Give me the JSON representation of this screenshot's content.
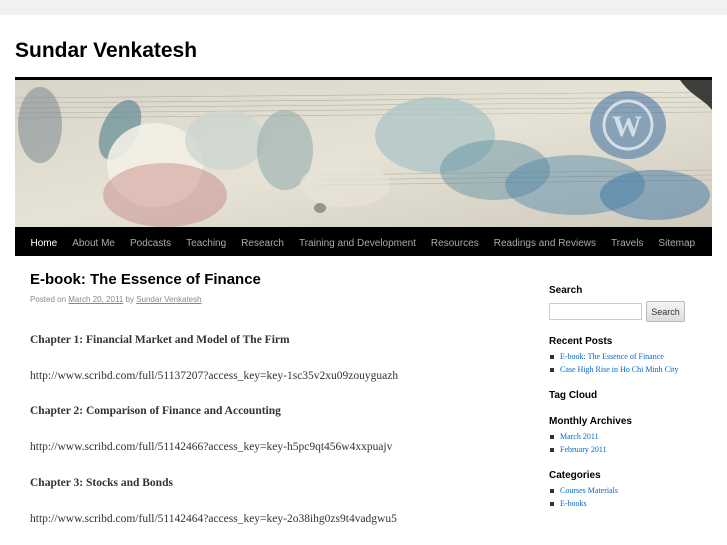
{
  "site": {
    "title": "Sundar Venkatesh"
  },
  "nav": {
    "items": [
      {
        "label": "Home",
        "current": true
      },
      {
        "label": "About Me"
      },
      {
        "label": "Podcasts"
      },
      {
        "label": "Teaching"
      },
      {
        "label": "Research"
      },
      {
        "label": "Training and Development"
      },
      {
        "label": "Resources"
      },
      {
        "label": "Readings and Reviews"
      },
      {
        "label": "Travels"
      },
      {
        "label": "Sitemap"
      }
    ]
  },
  "post": {
    "title": "E-book: The Essence of Finance",
    "meta": {
      "posted_on": "Posted on",
      "date": "March 20, 2011",
      "by": "by",
      "author": "Sundar Venkatesh"
    },
    "chapters": [
      {
        "heading": "Chapter 1: Financial Market and Model of The Firm",
        "link": "http://www.scribd.com/full/51137207?access_key=key-1sc35v2xu09zouyguazh"
      },
      {
        "heading": "Chapter 2: Comparison of Finance and Accounting",
        "link": "http://www.scribd.com/full/51142466?access_key=key-h5pc9qt456w4xxpuajv"
      },
      {
        "heading": "Chapter 3: Stocks and Bonds",
        "link": "http://www.scribd.com/full/51142464?access_key=key-2o38ihg0zs9t4vadgwu5"
      }
    ]
  },
  "sidebar": {
    "search": {
      "title": "Search",
      "placeholder": "",
      "button": "Search"
    },
    "recent_posts": {
      "title": "Recent Posts",
      "items": [
        "E-book: The Essence of Finance",
        "Case High Rise in Ho Chi Minh City"
      ]
    },
    "tag_cloud": {
      "title": "Tag Cloud"
    },
    "archives": {
      "title": "Monthly Archives",
      "items": [
        "March 2011",
        "February 2011"
      ]
    },
    "categories": {
      "title": "Categories",
      "items": [
        "Courses Materials",
        "E-books"
      ]
    }
  },
  "colors": {
    "nav_bg": "#000000",
    "link": "#0066cc",
    "page_bg": "#f1f1f1"
  }
}
